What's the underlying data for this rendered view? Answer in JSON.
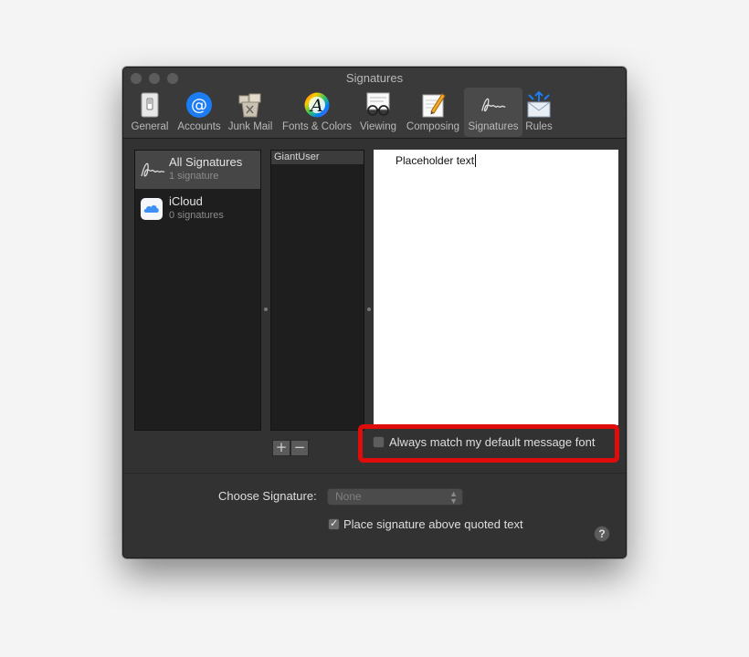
{
  "window": {
    "title": "Signatures"
  },
  "toolbar": {
    "items": [
      {
        "label": "General",
        "icon": "switch-icon"
      },
      {
        "label": "Accounts",
        "icon": "at-sign-icon"
      },
      {
        "label": "Junk Mail",
        "icon": "junk-mail-icon"
      },
      {
        "label": "Fonts & Colors",
        "icon": "font-color-wheel-icon"
      },
      {
        "label": "Viewing",
        "icon": "eyeglasses-icon"
      },
      {
        "label": "Composing",
        "icon": "composing-pencil-icon"
      },
      {
        "label": "Signatures",
        "icon": "signature-icon"
      },
      {
        "label": "Rules",
        "icon": "rules-envelope-icon"
      }
    ],
    "selected": "Signatures"
  },
  "accounts": [
    {
      "name": "All Signatures",
      "count": "1 signature",
      "icon": "signature-icon"
    },
    {
      "name": "iCloud",
      "count": "0 signatures",
      "icon": "icloud-icon"
    }
  ],
  "signatures": [
    {
      "name": "GiantUser"
    }
  ],
  "editor": {
    "text": "Placeholder text"
  },
  "list_buttons": {
    "add": "+",
    "remove": "−"
  },
  "options": {
    "match_font_label": "Always match my default message font",
    "match_font_checked": false,
    "choose_signature_label": "Choose Signature:",
    "choose_signature_value": "None",
    "place_above_label": "Place signature above quoted text",
    "place_above_checked": true,
    "help": "?"
  },
  "colors": {
    "highlight": "#e00b0b",
    "accounts_blue": "#1b7cf3"
  }
}
